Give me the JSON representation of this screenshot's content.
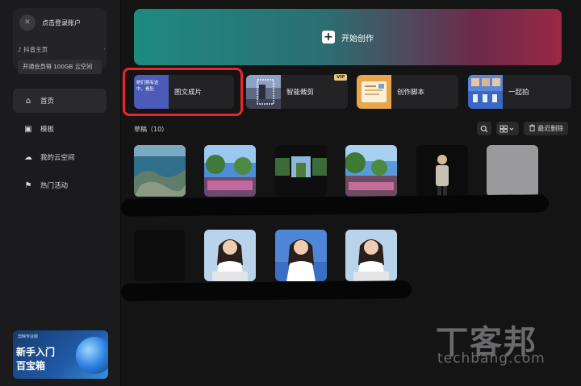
{
  "sidebar": {
    "account": {
      "login_label": "点击登录账户",
      "douyin_label": "♪ 抖音主页",
      "douyin_chevron": "›",
      "vip_label": "开通会员得 100GB 云空间"
    },
    "nav": [
      {
        "label": "首页",
        "icon": "home-icon",
        "glyph": "⌂"
      },
      {
        "label": "模板",
        "icon": "template-icon",
        "glyph": "▣"
      },
      {
        "label": "我的云空间",
        "icon": "cloud-icon",
        "glyph": "☁"
      },
      {
        "label": "热门活动",
        "icon": "flag-icon",
        "glyph": "⚑"
      }
    ],
    "promo": {
      "small": "剪映专业版",
      "line1": "新手入门",
      "line2": "百宝箱"
    }
  },
  "hero": {
    "label": "开始创作",
    "icon": "plus-icon"
  },
  "quick_actions": [
    {
      "label": "图文成片",
      "thumb_text": "她们拥有这\n中，看肚"
    },
    {
      "label": "智能裁剪",
      "badge": "VIP"
    },
    {
      "label": "创作脚本"
    },
    {
      "label": "一起拍"
    }
  ],
  "drafts": {
    "title": "草稿（10）",
    "recent_delete_label": "最近删除",
    "view_toggle_icon": "grid-view-icon"
  },
  "colors": {
    "highlight": "#e8262c",
    "hero_start": "#1e8a80",
    "hero_end": "#9a2846",
    "vip_badge": "#e6c98a"
  },
  "watermark": {
    "big": "丅客邦",
    "small": "techbang.com"
  }
}
